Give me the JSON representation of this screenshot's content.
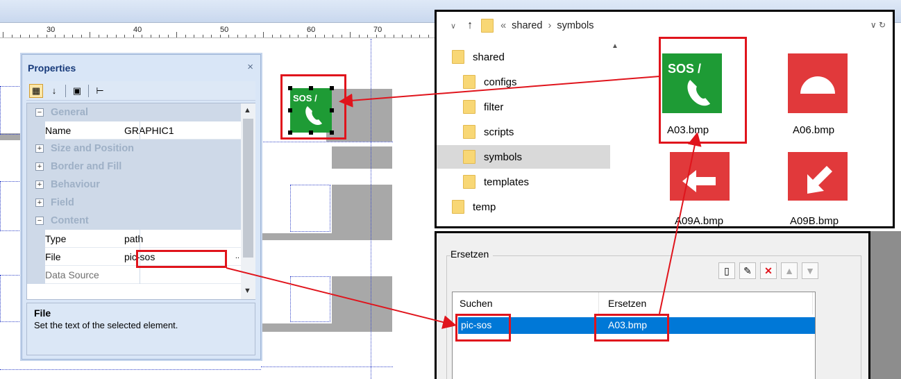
{
  "ruler": {
    "labels": [
      "30",
      "40",
      "50",
      "60",
      "70"
    ]
  },
  "properties": {
    "title": "Properties",
    "close": "×",
    "rows": [
      {
        "kind": "cat",
        "toggle": "−",
        "label": "General"
      },
      {
        "kind": "prop",
        "key": "Name",
        "value": "GRAPHIC1"
      },
      {
        "kind": "cat",
        "toggle": "+",
        "label": "Size and Position"
      },
      {
        "kind": "cat",
        "toggle": "+",
        "label": "Border and Fill"
      },
      {
        "kind": "cat",
        "toggle": "+",
        "label": "Behaviour"
      },
      {
        "kind": "cat",
        "toggle": "+",
        "label": "Field"
      },
      {
        "kind": "cat",
        "toggle": "−",
        "label": "Content"
      },
      {
        "kind": "prop",
        "key": "Type",
        "value": "path"
      },
      {
        "kind": "prop",
        "key": "File",
        "value": "pic-sos"
      },
      {
        "kind": "prop",
        "key": "Data Source",
        "value": ""
      }
    ],
    "file_ellipsis": "..",
    "description": {
      "title": "File",
      "text": "Set the text of the selected element."
    }
  },
  "graphic": {
    "text": "SOS /",
    "accent": "#1e9b35"
  },
  "explorer": {
    "path_prefix": "«",
    "path": [
      "shared",
      "symbols"
    ],
    "tree": [
      "shared",
      "configs",
      "filter",
      "scripts",
      "symbols",
      "templates",
      "temp"
    ],
    "selected": "symbols",
    "files": [
      {
        "name": "A03.bmp",
        "icon": "sos-phone-icon",
        "color": "#1e9b35",
        "text": "SOS /"
      },
      {
        "name": "A06.bmp",
        "icon": "semicircle-icon",
        "color": "#e1393b"
      },
      {
        "name": "A09A.bmp",
        "icon": "arrow-left-icon",
        "color": "#e1393b"
      },
      {
        "name": "A09B.bmp",
        "icon": "arrow-down-left-icon",
        "color": "#e1393b"
      }
    ]
  },
  "replace": {
    "group_title": "Ersetzen",
    "columns": [
      "Suchen",
      "Ersetzen"
    ],
    "rows": [
      {
        "search": "pic-sos",
        "replace": "A03.bmp"
      }
    ]
  },
  "colors": {
    "highlight": "#e0141c",
    "selection": "#0078d7"
  }
}
